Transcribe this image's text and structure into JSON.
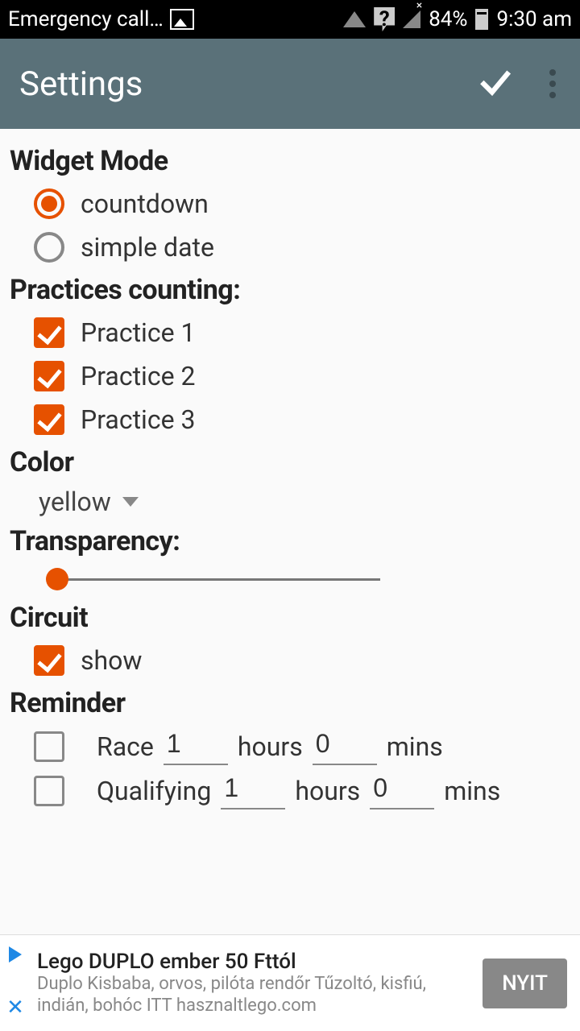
{
  "status": {
    "left_text": "Emergency call…",
    "battery": "84%",
    "time": "9:30 am"
  },
  "header": {
    "title": "Settings"
  },
  "widget_mode": {
    "title": "Widget Mode",
    "options": [
      {
        "label": "countdown",
        "selected": true
      },
      {
        "label": "simple date",
        "selected": false
      }
    ]
  },
  "practices": {
    "title": "Practices counting:",
    "items": [
      {
        "label": "Practice 1",
        "checked": true
      },
      {
        "label": "Practice 2",
        "checked": true
      },
      {
        "label": "Practice 3",
        "checked": true
      }
    ]
  },
  "color": {
    "title": "Color",
    "value": "yellow"
  },
  "transparency": {
    "title": "Transparency:",
    "value_pct": 2
  },
  "circuit": {
    "title": "Circuit",
    "show_label": "show",
    "checked": true
  },
  "reminder": {
    "title": "Reminder",
    "rows": [
      {
        "label": "Race",
        "hours": "1",
        "mins": "0",
        "checked": false
      },
      {
        "label": "Qualifying",
        "hours": "1",
        "mins": "0",
        "checked": false
      }
    ],
    "hours_unit": "hours",
    "mins_unit": "mins"
  },
  "ad": {
    "title": "Lego DUPLO ember 50 Fttól",
    "desc": "Duplo Kisbaba, orvos, pilóta rendőr Tűzoltó, kisfiú, indián, bohóc ITT hasznaltlego.com",
    "button": "NYIT"
  }
}
